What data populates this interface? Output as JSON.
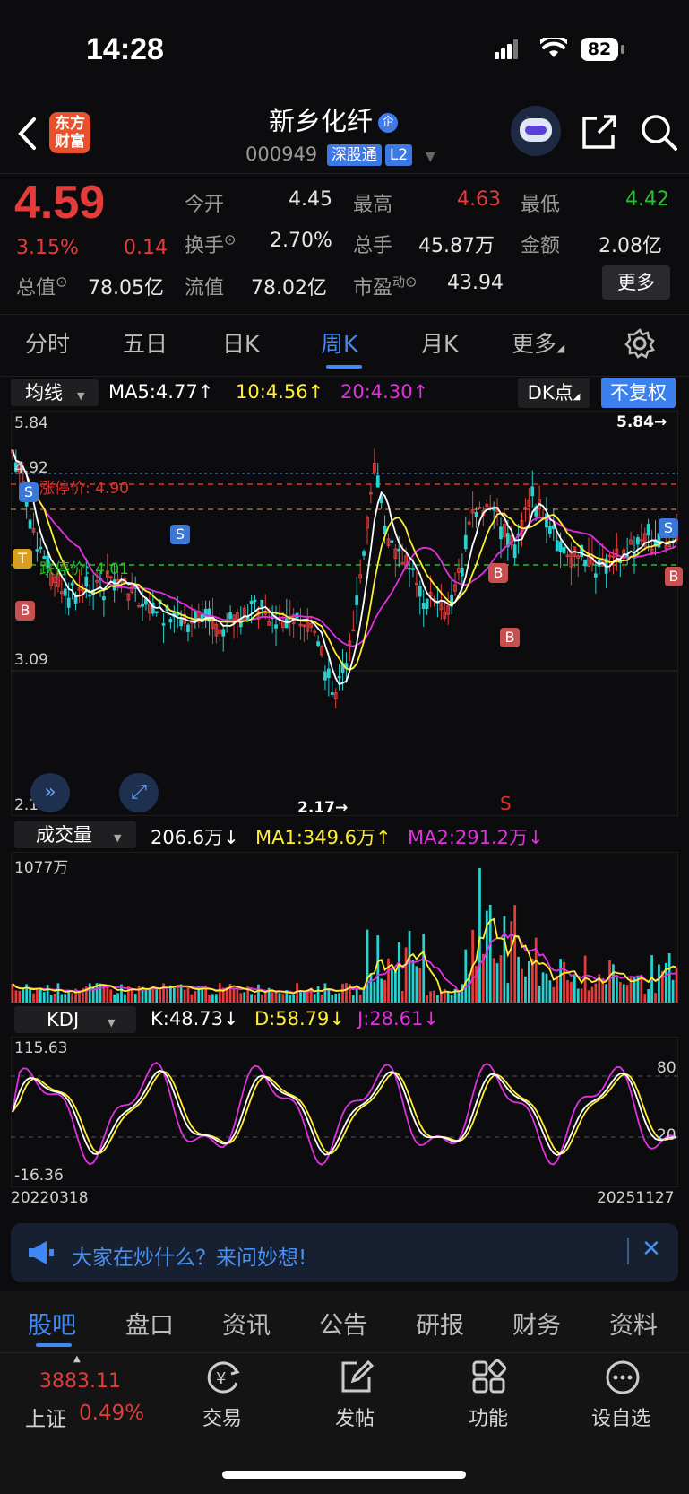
{
  "status": {
    "time": "14:28",
    "battery": "82"
  },
  "header": {
    "logo": "东方财富",
    "title": "新乡化纤",
    "title_badge": "企",
    "code": "000949",
    "tag1": "深股通",
    "tag2": "L2"
  },
  "quote": {
    "price": "4.59",
    "change_pct": "3.15%",
    "change": "0.14",
    "open_label": "今开",
    "open": "4.45",
    "high_label": "最高",
    "high": "4.63",
    "low_label": "最低",
    "low": "4.42",
    "turnover_label": "换手",
    "turnover": "2.70%",
    "volume_label": "总手",
    "volume": "45.87万",
    "amount_label": "金额",
    "amount": "2.08亿",
    "mcap_label": "总值",
    "mcap": "78.05亿",
    "float_label": "流值",
    "float": "78.02亿",
    "pe_label": "市盈",
    "pe_sup": "动",
    "pe": "43.94",
    "more": "更多"
  },
  "period_tabs": [
    "分时",
    "五日",
    "日K",
    "周K",
    "月K",
    "更多"
  ],
  "active_tab": "周K",
  "main_chart": {
    "indicator": "均线",
    "ma5": "MA5:4.77↑",
    "ma10": "10:4.56↑",
    "ma20": "20:4.30↑",
    "dk_button": "DK点",
    "adjust_button": "不复权",
    "y_top": "5.84",
    "y_mid1": "4.92",
    "y_mid2": "3.09",
    "y_bottom": "2.1",
    "limit_up_label": "涨停价: 4.90",
    "limit_down_label": "跌停价: 4.01",
    "max_marker": "5.84→",
    "min_marker": "2.17→",
    "s_marker": "S",
    "colors": {
      "ma5": "#ffffff",
      "ma10": "#ffee33",
      "ma20": "#e030e0",
      "up": "#e63c3c",
      "down": "#2ad1d1"
    }
  },
  "volume_chart": {
    "indicator": "成交量",
    "value": "206.6万↓",
    "ma1": "MA1:349.6万↑",
    "ma2": "MA2:291.2万↓",
    "y_top": "1077万"
  },
  "kdj_chart": {
    "indicator": "KDJ",
    "k": "K:48.73↓",
    "d": "D:58.79↓",
    "j": "J:28.61↓",
    "y_top": "115.63",
    "y_bottom": "-16.36",
    "level80": "80",
    "level20": "20",
    "date_start": "20220318",
    "date_end": "20251127"
  },
  "news": {
    "text": "大家在炒什么？来问妙想!"
  },
  "bottom_tabs": [
    "股吧",
    "盘口",
    "资讯",
    "公告",
    "研报",
    "财务",
    "资料"
  ],
  "dock": {
    "index_value": "3883.11",
    "index_name": "上证",
    "index_change": "0.49%",
    "trade": "交易",
    "post": "发帖",
    "function": "功能",
    "watch": "设自选"
  }
}
